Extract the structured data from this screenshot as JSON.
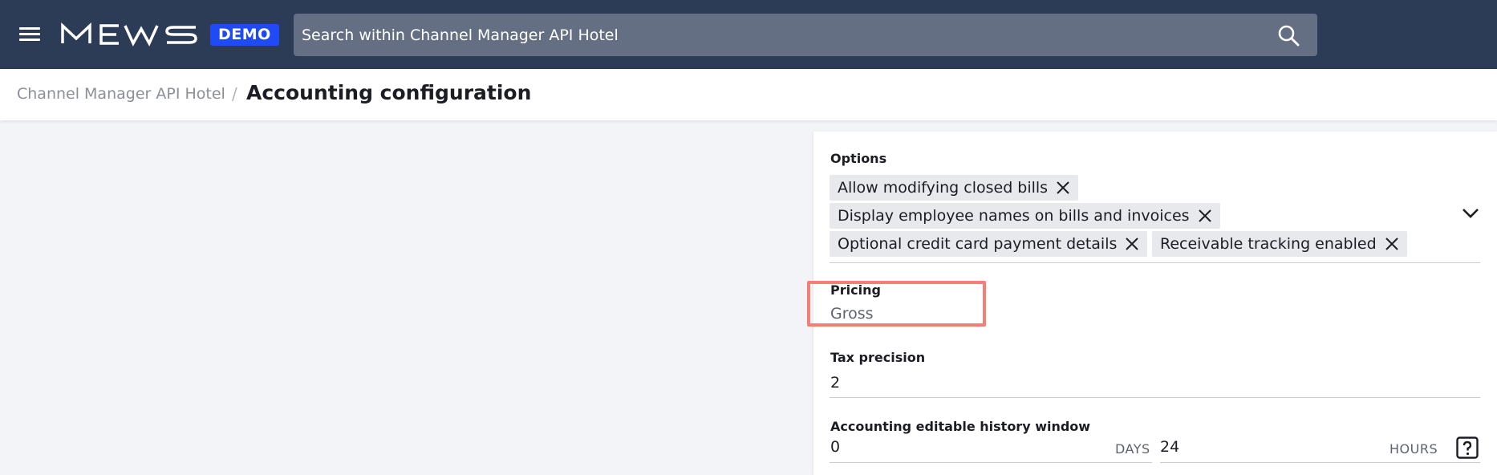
{
  "topbar": {
    "logo_text": "MEWS",
    "demo_badge": "DEMO",
    "search_placeholder": "Search within Channel Manager API Hotel",
    "colors": {
      "bar": "#2c3b56",
      "badge": "#1f4bf6",
      "search_bg": "#646f84"
    },
    "icons": [
      "menu-icon",
      "search-icon"
    ]
  },
  "header": {
    "breadcrumb": "Channel Manager API Hotel",
    "separator": "/",
    "title": "Accounting configuration"
  },
  "form": {
    "options": {
      "label": "Options",
      "chips": [
        "Allow modifying closed bills",
        "Display employee names on bills and invoices",
        "Optional credit card payment details",
        "Receivable tracking enabled"
      ]
    },
    "pricing": {
      "label": "Pricing",
      "value": "Gross"
    },
    "tax_precision": {
      "label": "Tax precision",
      "value": "2"
    },
    "history_window": {
      "label": "Accounting editable history window",
      "days_value": "0",
      "days_unit": "DAYS",
      "hours_value": "24",
      "hours_unit": "HOURS"
    }
  },
  "highlight_color": "#f57f77"
}
